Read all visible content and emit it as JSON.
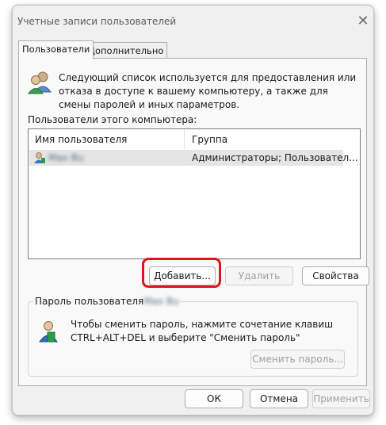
{
  "window": {
    "title": "Учетные записи пользователей",
    "close_glyph": "✕"
  },
  "tabs": [
    {
      "label": "Пользователи"
    },
    {
      "label": "Дополнительно"
    }
  ],
  "info_text": "Следующий список используется для предоставления или отказа в доступе к вашему компьютеру, а также для смены паролей и иных параметров.",
  "users_label": "Пользователи этого компьютера:",
  "table": {
    "columns": [
      "Имя пользователя",
      "Группа"
    ],
    "rows": [
      {
        "user": "Маx Bu",
        "group": "Администраторы; Пользовател..."
      }
    ]
  },
  "buttons": {
    "add": "Добавить...",
    "remove": "Удалить",
    "properties": "Свойства"
  },
  "password_group": {
    "title": "Пароль пользователя",
    "user": "Маx Bu",
    "text": "Чтобы сменить пароль, нажмите сочетание клавиш CTRL+ALT+DEL и выберите \"Сменить пароль\"",
    "button": "Сменить пароль..."
  },
  "footer": {
    "ok": "ОК",
    "cancel": "Отмена",
    "apply": "Применить"
  },
  "colors": {
    "highlight": "#e0141b",
    "selection": "#e5e5e5"
  }
}
